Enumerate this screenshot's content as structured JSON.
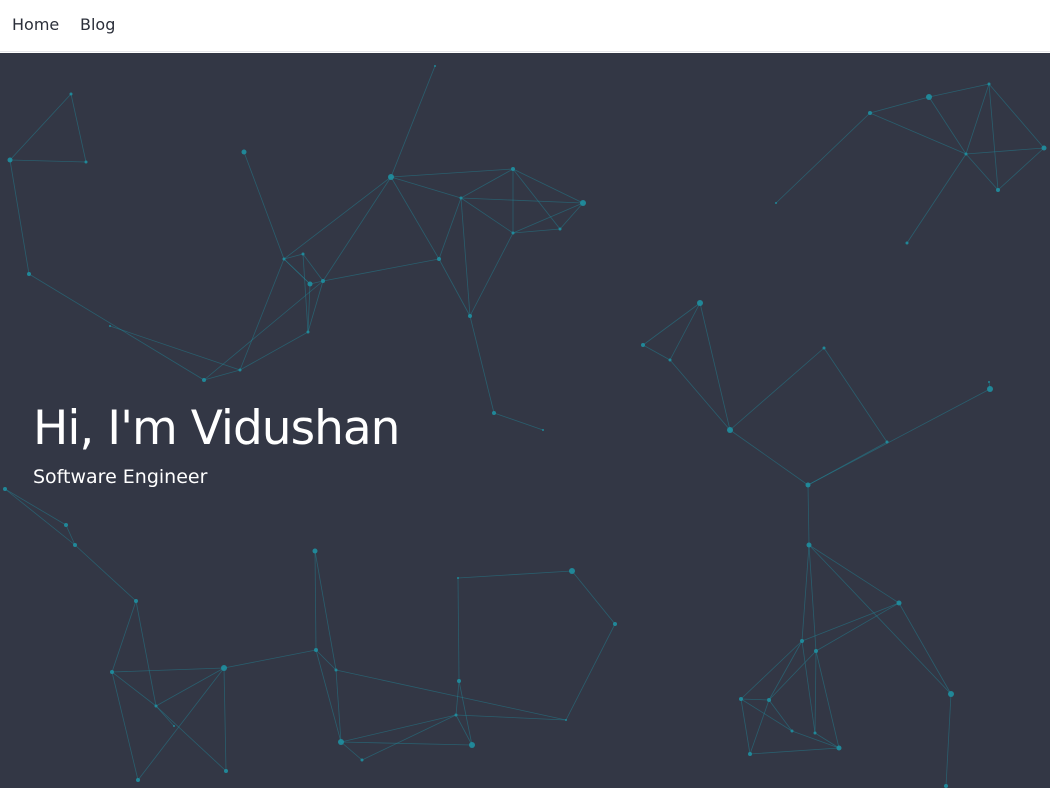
{
  "nav": {
    "home_label": "Home",
    "blog_label": "Blog"
  },
  "hero": {
    "title": "Hi, I'm Vidushan",
    "subtitle": "Software Engineer"
  },
  "colors": {
    "nav_background": "#ffffff",
    "hero_background": "#333745",
    "particle_color": "#1f8fa0",
    "text_light": "#ffffff",
    "text_dark": "#2b2f3a"
  },
  "icons": {
    "background": "particle-network"
  }
}
